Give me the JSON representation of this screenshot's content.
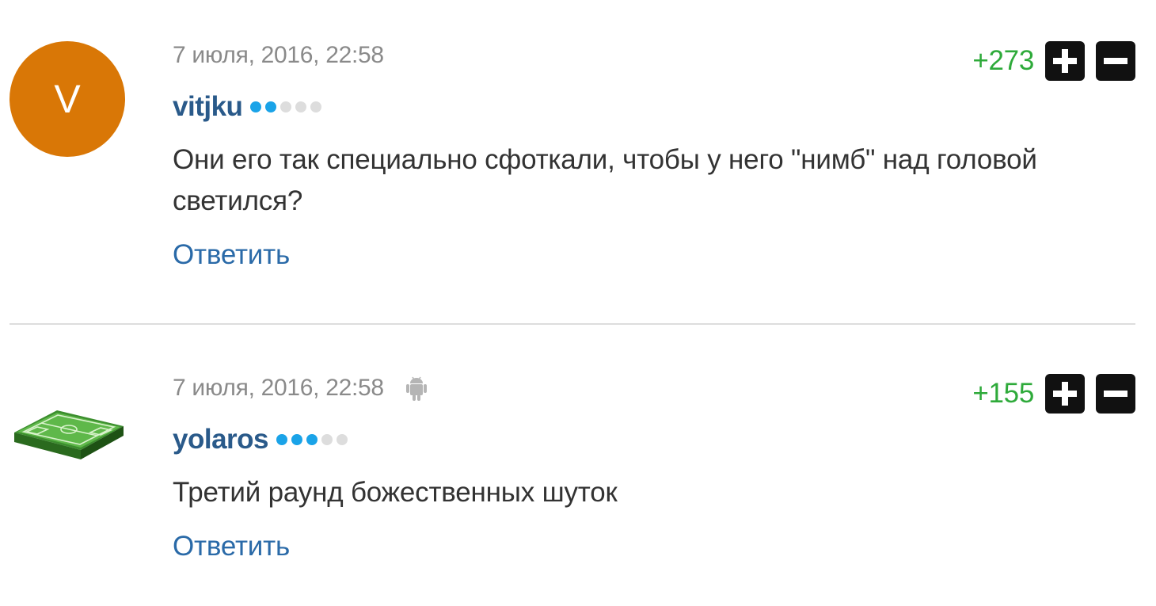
{
  "comments": [
    {
      "date": "7 июля, 2016, 22:58",
      "avatar_letter": "V",
      "avatar_color": "#d97706",
      "username": "vitjku",
      "rank_level": 2,
      "rank_max": 5,
      "score": "+273",
      "text": "Они его так специально сфоткали, чтобы у него \"нимб\" над головой светился?",
      "reply_label": "Ответить",
      "device_icon": null
    },
    {
      "date": "7 июля, 2016, 22:58",
      "avatar_image": "football-field-icon",
      "username": "yolaros",
      "rank_level": 3,
      "rank_max": 5,
      "score": "+155",
      "text": "Третий раунд божественных шуток",
      "reply_label": "Ответить",
      "device_icon": "android-icon"
    }
  ],
  "colors": {
    "score": "#2eaa3a",
    "username": "#2a5a8a",
    "reply_link": "#2a6aa8",
    "rank_filled": "#1aa3e8",
    "rank_empty": "#dddddd",
    "vote_button": "#111111"
  },
  "icons": {
    "upvote": "plus-icon",
    "downvote": "minus-icon"
  }
}
